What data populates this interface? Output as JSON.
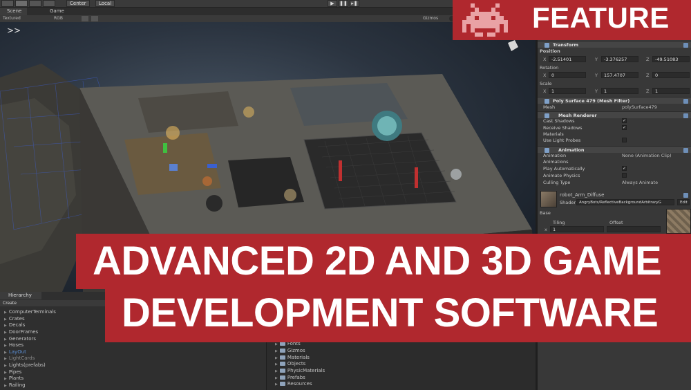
{
  "toolbar": {
    "pivot_label": "Center",
    "space_label": "Local",
    "play_icon": "play-icon",
    "pause_icon": "pause-icon",
    "step_icon": "step-icon"
  },
  "tabs": [
    {
      "label": "Scene"
    },
    {
      "label": "Game"
    }
  ],
  "scene_bar": {
    "shading": "Textured",
    "render_mode": "RGB",
    "gizmos": "Gizmos",
    "search_icon": "search-icon"
  },
  "inspector": {
    "transform": {
      "title": "Transform",
      "position_label": "Position",
      "position": {
        "x": "-2.51401",
        "y": "-3.376257",
        "z": "-49.51083"
      },
      "rotation_label": "Rotation",
      "rotation": {
        "x": "0",
        "y": "157.4707",
        "z": "0"
      },
      "scale_label": "Scale",
      "scale": {
        "x": "1",
        "y": "1",
        "z": "1"
      }
    },
    "mesh_filter": {
      "title": "Poly Surface 479 (Mesh Filter)",
      "mesh_label": "Mesh",
      "mesh_value": "polySurface479"
    },
    "mesh_renderer": {
      "title": "Mesh Renderer",
      "cast_shadows": "Cast Shadows",
      "receive_shadows": "Receive Shadows",
      "materials": "Materials",
      "use_light_probes": "Use Light Probes"
    },
    "animation": {
      "title": "Animation",
      "animation_label": "Animation",
      "animation_value": "None (Animation Clip)",
      "animations": "Animations",
      "play_automatically": "Play Automatically",
      "animate_physics": "Animate Physics",
      "culling_type": "Culling Type",
      "culling_value": "Always Animate"
    },
    "material": {
      "name": "robot_Arm_Diffuse",
      "shader_label": "Shader",
      "shader_value": "AngryBots/ReflectiveBackgroundArbitraryG",
      "edit": "Edit",
      "base_label": "Base",
      "tiling_label": "Tiling",
      "offset_label": "Offset",
      "tiling_x": "1"
    }
  },
  "hierarchy": {
    "tab_label": "Hierarchy",
    "create_label": "Create",
    "items": [
      {
        "label": "ComputerTerminals",
        "state": "normal"
      },
      {
        "label": "Crates",
        "state": "normal"
      },
      {
        "label": "Decals",
        "state": "normal"
      },
      {
        "label": "DoorFrames",
        "state": "normal"
      },
      {
        "label": "Generators",
        "state": "normal"
      },
      {
        "label": "Hoses",
        "state": "normal"
      },
      {
        "label": "LayOut",
        "state": "highlight"
      },
      {
        "label": "LightCards",
        "state": "dim"
      },
      {
        "label": "Lights(prefabs)",
        "state": "normal"
      },
      {
        "label": "Pipes",
        "state": "normal"
      },
      {
        "label": "Plants",
        "state": "normal"
      },
      {
        "label": "Railing",
        "state": "normal"
      }
    ]
  },
  "project": {
    "items": [
      {
        "label": "Fonts"
      },
      {
        "label": "Gizmos"
      },
      {
        "label": "Materials"
      },
      {
        "label": "Objects"
      },
      {
        "label": "PhysicMaterials"
      },
      {
        "label": "Prefabs"
      },
      {
        "label": "Resources"
      }
    ]
  },
  "overlay": {
    "feature_label": "FEATURE",
    "feature_icon": "space-invader-icon",
    "headline_line1": "ADVANCED 2D AND 3D GAME",
    "headline_line2": "DEVELOPMENT SOFTWARE",
    "accent_color": "#b0282e"
  }
}
